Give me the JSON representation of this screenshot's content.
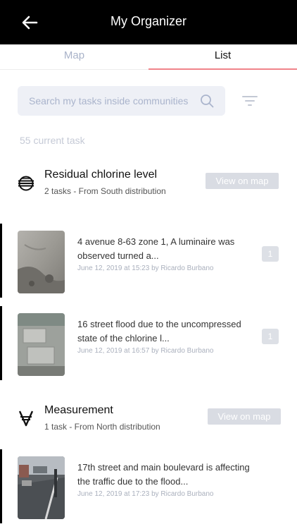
{
  "header": {
    "title": "My Organizer"
  },
  "tabs": [
    {
      "label": "Map"
    },
    {
      "label": "List"
    }
  ],
  "search": {
    "placeholder": "Search my tasks inside communities"
  },
  "task_count": "55 current task",
  "groups": [
    {
      "title": "Residual chlorine level",
      "subtitle": "2 tasks -  From South distribution",
      "button": "View on map",
      "icon": "water-system-icon",
      "tasks": [
        {
          "title": "4 avenue 8-63 zone 1, A luminaire was observed turned a...",
          "meta": "June 12, 2019 at 15:23 by Ricardo Burbano",
          "badge": "1"
        },
        {
          "title": "16 street flood due to the uncompressed state of the chlorine l...",
          "meta": "June 12, 2019 at 16:57 by Ricardo Burbano",
          "badge": "1"
        }
      ]
    },
    {
      "title": "Measurement",
      "subtitle": "1 task - From North distribution",
      "button": "View on map",
      "icon": "measurement-icon",
      "tasks": [
        {
          "title": "17th street and main boulevard is affecting the traffic due to the flood...",
          "meta": "June 12, 2019 at 17:23 by Ricardo Burbano",
          "badge": ""
        }
      ]
    }
  ],
  "colors": {
    "header_bg": "#000000",
    "tab_accent": "#f0838a",
    "search_bg": "#eef0f6",
    "button_bg": "#d9dce3"
  }
}
